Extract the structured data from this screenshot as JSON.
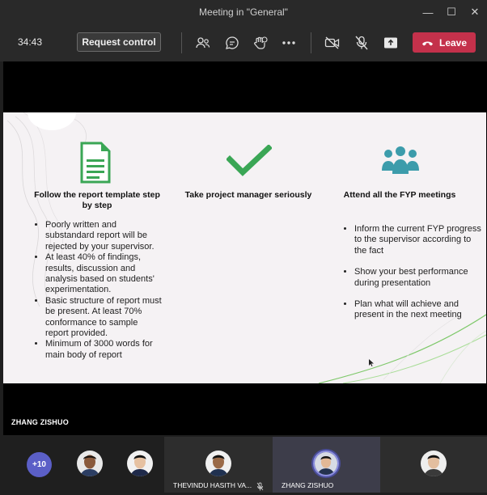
{
  "window": {
    "title": "Meeting in \"General\"",
    "controls": [
      "minimize-icon",
      "maximize-icon",
      "close-icon"
    ]
  },
  "toolbar": {
    "timer": "34:43",
    "request_control": "Request control",
    "icons": [
      "participants-icon",
      "chat-icon",
      "reactions-icon",
      "more-icon",
      "camera-off-icon",
      "mic-off-icon",
      "share-icon",
      "phone-icon"
    ],
    "leave": "Leave",
    "leave_color": "#c4314b"
  },
  "slide": {
    "columns": [
      {
        "icon": "document-icon",
        "heading": "Follow the report template step by step",
        "bullets": [
          "Poorly written and substandard report will be rejected by your supervisor.",
          "At least 40% of findings, results, discussion and analysis based on students' experimentation.",
          "Basic structure of report must be present.  At least 70% conformance to sample report provided.",
          "Minimum of 3000 words for main body of report"
        ]
      },
      {
        "icon": "checkmark-icon",
        "heading": "Take project manager seriously",
        "bullets": []
      },
      {
        "icon": "team-icon",
        "heading": "Attend all the FYP meetings",
        "bullets": [
          "Inform the current FYP progress to the supervisor according to the fact",
          "Show your best performance during presentation",
          "Plan what will achieve and present in the next meeting"
        ]
      }
    ],
    "accent_green": "#3aa655",
    "accent_teal": "#3c9cab"
  },
  "presenter": {
    "name": "ZHANG ZISHUO"
  },
  "participants": {
    "overflow": "+10",
    "tiles": [
      {
        "name": ""
      },
      {
        "name": ""
      },
      {
        "name": "THEVINDU HASITH VA..."
      },
      {
        "name": "ZHANG ZISHUO"
      },
      {
        "name": ""
      }
    ]
  }
}
